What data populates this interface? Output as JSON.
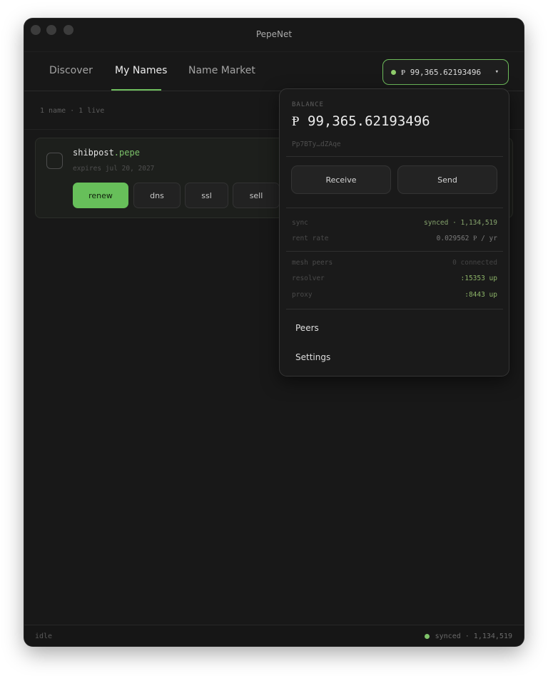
{
  "window": {
    "title": "PepeNet"
  },
  "nav": {
    "tabs": [
      {
        "label": "Discover",
        "active": false
      },
      {
        "label": "My Names",
        "active": true
      },
      {
        "label": "Name Market",
        "active": false
      }
    ],
    "balance_pill": {
      "text": "Ᵽ 99,365.62193496",
      "caret": "▾"
    }
  },
  "summary": {
    "text": "1 name · 1 live"
  },
  "names": [
    {
      "name": "shibpost",
      "tld": ".pepe",
      "expires": "expires jul 20, 2027",
      "actions": [
        "renew",
        "dns",
        "ssl",
        "sell"
      ]
    }
  ],
  "wallet_dropdown": {
    "caption": "BALANCE",
    "amount": "Ᵽ 99,365.62193496",
    "address": "Pp7BTy…dZAqe",
    "receive_label": "Receive",
    "send_label": "Send",
    "stats": [
      {
        "key": "sync",
        "value": "synced · 1,134,519"
      },
      {
        "key": "rent rate",
        "value": "0.029562 Ᵽ / yr"
      },
      {
        "key": "mesh peers",
        "value": "0 connected"
      },
      {
        "key": "resolver",
        "value": ":15353 up"
      },
      {
        "key": "proxy",
        "value": ":8443 up"
      }
    ],
    "menu": [
      "Peers",
      "Settings"
    ]
  },
  "statusbar": {
    "left": "idle",
    "right": "synced · 1,134,519"
  },
  "colors": {
    "accent": "#67bf5a",
    "background": "#181818",
    "panel": "#1a1a1a"
  }
}
